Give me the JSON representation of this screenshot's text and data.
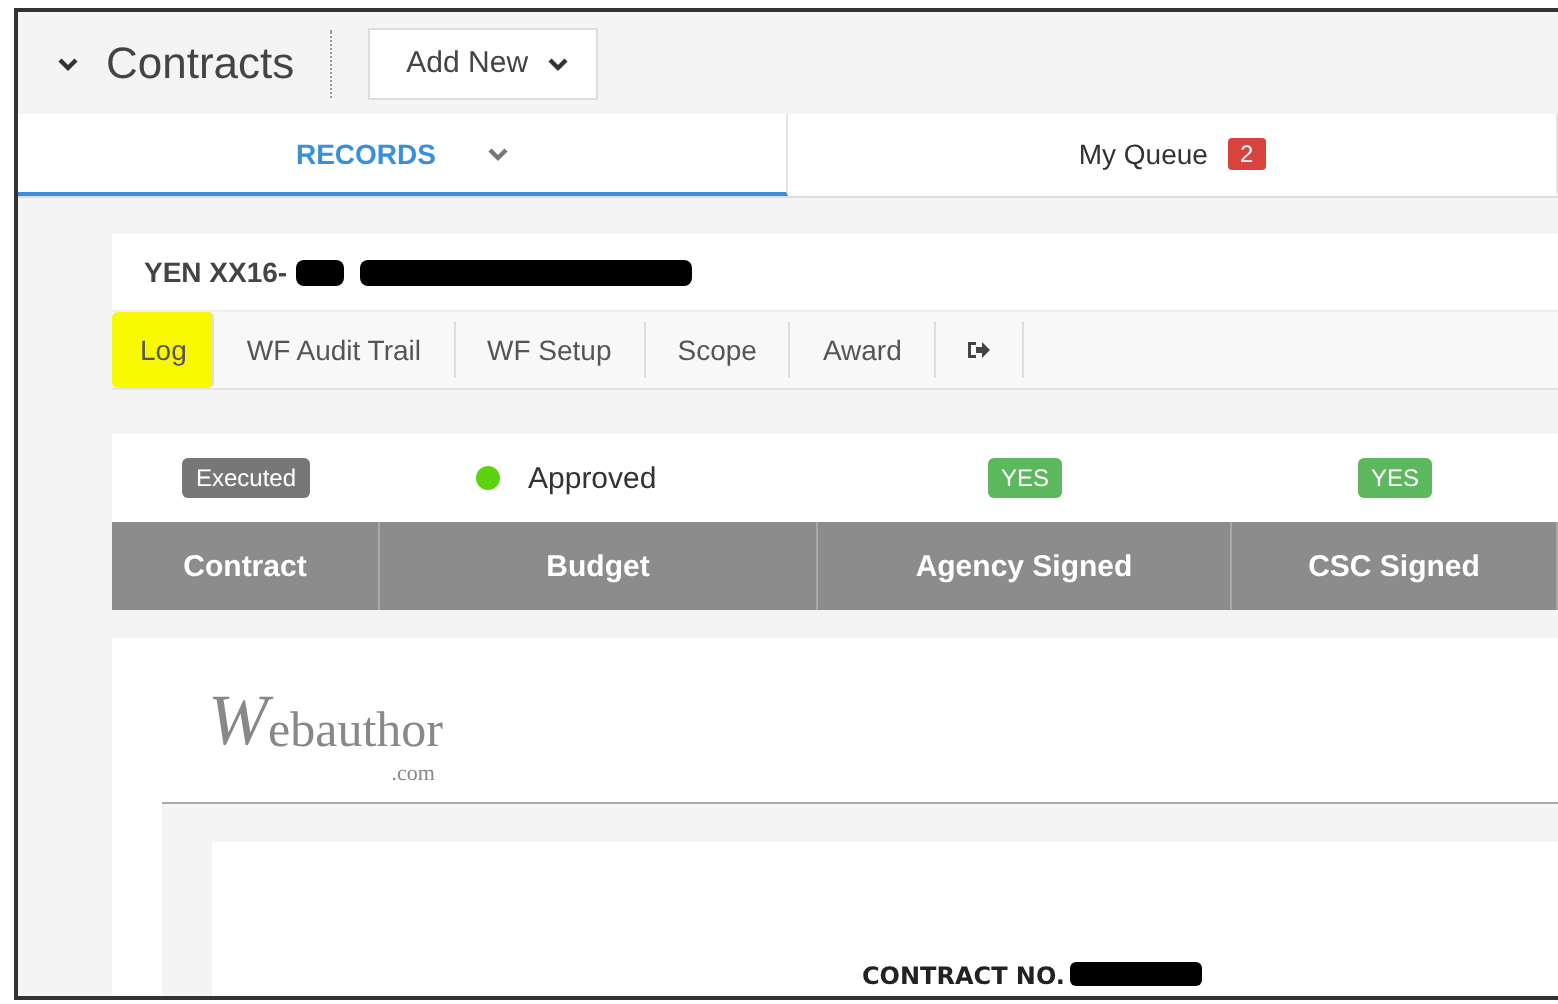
{
  "header": {
    "title": "Contracts",
    "add_button": "Add New"
  },
  "tabs": [
    {
      "label": "RECORDS",
      "selected": true,
      "has_menu": true
    },
    {
      "label": "My Queue",
      "selected": false,
      "has_menu": false,
      "badge": "2"
    }
  ],
  "record": {
    "title": "YEN XX16-",
    "redacted": true,
    "subtabs": [
      {
        "kind": "text",
        "label": "Log",
        "highlighted": true
      },
      {
        "kind": "text",
        "label": "WF Audit Trail",
        "highlighted": false
      },
      {
        "kind": "text",
        "label": "WF Setup",
        "highlighted": false
      },
      {
        "kind": "text",
        "label": "Scope",
        "highlighted": false
      },
      {
        "kind": "text",
        "label": "Award",
        "highlighted": false
      },
      {
        "kind": "icon",
        "highlighted": false
      }
    ],
    "status": [
      {
        "kind": "tag",
        "text": "Executed"
      },
      {
        "kind": "dot",
        "text": "Approved",
        "color": "#5cd30c"
      },
      {
        "kind": "flag",
        "text": "YES"
      },
      {
        "kind": "flag",
        "text": "YES"
      }
    ],
    "columns": [
      "Contract",
      "Budget",
      "Agency Signed",
      "CSC Signed"
    ]
  },
  "document": {
    "logo": "Webauthor",
    "logo_suffix": ".com",
    "contract_label": "CONTRACT NO.",
    "redacted": true
  }
}
